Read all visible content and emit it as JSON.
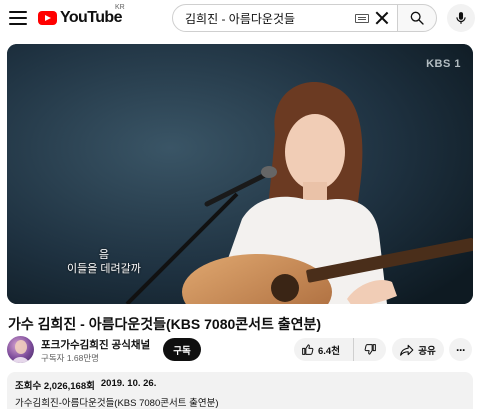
{
  "header": {
    "logo_text": "YouTube",
    "region": "KR",
    "search_value": "김희진 - 아름다운것들"
  },
  "player": {
    "broadcaster": "KBS 1",
    "subtitle_line1": "음",
    "subtitle_line2": "이들을 데려갈까"
  },
  "video": {
    "title": "가수 김희진 - 아름다운것들(KBS 7080콘서트 출연분)"
  },
  "channel": {
    "name": "포크가수김희진 공식채널",
    "subscribers": "구독자 1.68만명",
    "subscribe_label": "구독"
  },
  "actions": {
    "like_count": "6.4천",
    "share_label": "공유",
    "more_label": "···"
  },
  "description": {
    "views": "조회수 2,026,168회",
    "date": "2019. 10. 26.",
    "text": "가수김희진-아름다운것들(KBS 7080콘서트 출연분)"
  },
  "colors": {
    "brand_red": "#ff0000",
    "subscribe_bg": "#0f0f0f",
    "chip_bg": "#f2f2f2"
  },
  "icons": [
    "menu-icon",
    "youtube-logo-icon",
    "keyboard-icon",
    "clear-icon",
    "search-icon",
    "mic-icon",
    "like-icon",
    "dislike-icon",
    "share-icon",
    "more-icon"
  ]
}
